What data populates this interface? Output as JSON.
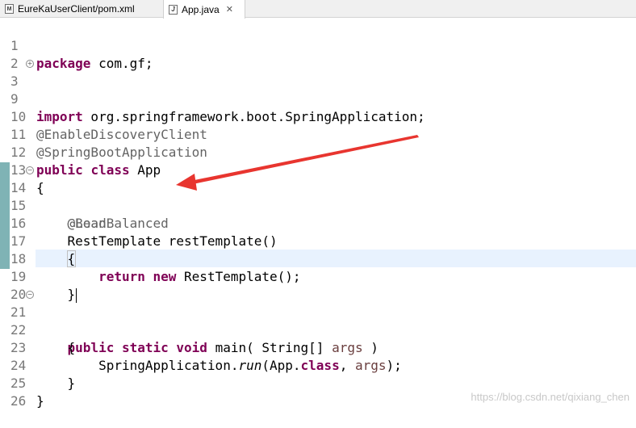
{
  "tabs": [
    {
      "label": "EureKaUserClient/pom.xml",
      "icon": "xml-file-icon",
      "active": false
    },
    {
      "label": "App.java",
      "icon": "java-file-icon",
      "active": true,
      "close": "✕"
    }
  ],
  "code_lines": [
    {
      "num": "1",
      "text": "package com.gf;"
    },
    {
      "num": "2",
      "text": ""
    },
    {
      "num": "3",
      "text": "import org.springframework.boot.SpringApplication;"
    },
    {
      "num": "9",
      "text": ""
    },
    {
      "num": "10",
      "text": "@EnableDiscoveryClient"
    },
    {
      "num": "11",
      "text": "@SpringBootApplication"
    },
    {
      "num": "12",
      "text": "public class App"
    },
    {
      "num": "13",
      "text": "{"
    },
    {
      "num": "14",
      "text": "    @Bean"
    },
    {
      "num": "15",
      "text": "    @LoadBalanced"
    },
    {
      "num": "16",
      "text": "    RestTemplate restTemplate()"
    },
    {
      "num": "17",
      "text": "    {"
    },
    {
      "num": "18",
      "text": "        return new RestTemplate();"
    },
    {
      "num": "19",
      "text": "    }"
    },
    {
      "num": "20",
      "text": ""
    },
    {
      "num": "21",
      "text": "    public static void main( String[] args )"
    },
    {
      "num": "22",
      "text": "    {"
    },
    {
      "num": "23",
      "text": "        SpringApplication.run(App.class, args);"
    },
    {
      "num": "24",
      "text": "    }"
    },
    {
      "num": "25",
      "text": "}"
    },
    {
      "num": "26",
      "text": ""
    }
  ],
  "tokens": {
    "package_kw": "package",
    "package_name": " com.gf;",
    "import_kw": "import",
    "import_name": " org.springframework.boot.SpringApplication;",
    "ann_discovery": "@EnableDiscoveryClient",
    "ann_springboot": "@SpringBootApplication",
    "public_kw": "public",
    "class_kw": "class",
    "class_name": " App",
    "open_brace": "{",
    "close_brace": "}",
    "ann_bean": "@Bean",
    "ann_loadbalanced": "@LoadBalanced",
    "rest_sig": "RestTemplate restTemplate()",
    "return_kw": "return",
    "new_kw": "new",
    "rest_ctor": " RestTemplate();",
    "static_kw": "static",
    "void_kw": "void",
    "main_sig_a": " main( String[] ",
    "args": "args",
    "main_sig_b": " )",
    "spring_app": "SpringApplication.",
    "run": "run",
    "app_ref": "(App.",
    "args_end": ");"
  },
  "folds": {
    "collapsed": "+",
    "expanded": "−"
  },
  "annotation_arrow_color": "#e8352f",
  "watermark": "https://blog.csdn.net/qixiang_chen"
}
